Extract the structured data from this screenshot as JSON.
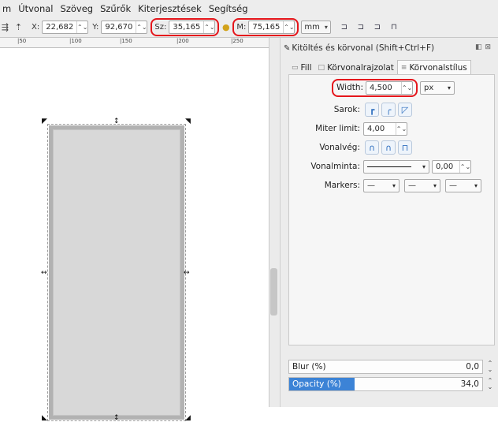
{
  "menu": [
    "m",
    "Útvonal",
    "Szöveg",
    "Szűrők",
    "Kiterjesztések",
    "Segítség"
  ],
  "toolbar": {
    "x_label": "X:",
    "x_value": "22,682",
    "y_label": "Y:",
    "y_value": "92,670",
    "w_label": "Sz:",
    "w_value": "35,165",
    "h_label": "M:",
    "h_value": "75,165",
    "unit": "mm",
    "lock_icon": "lock-icon",
    "icons": [
      "align-icon",
      "raise-icon",
      "snap-corner-icon",
      "snap-edge-icon",
      "snap-path-icon",
      "snap-node-icon"
    ]
  },
  "ruler": {
    "ticks": [
      "|50",
      "|100",
      "|150",
      "|200",
      "|250"
    ]
  },
  "panel": {
    "title": "Kitöltés és körvonal (Shift+Ctrl+F)",
    "tabs": [
      {
        "label": "Fill",
        "icon": "fill-icon"
      },
      {
        "label": "Körvonalrajzolat",
        "icon": "stroke-paint-icon"
      },
      {
        "label": "Körvonalstílus",
        "icon": "stroke-style-icon"
      }
    ],
    "width_label": "Width:",
    "width_value": "4,500",
    "width_unit": "px",
    "corners_label": "Sarok:",
    "miter_label": "Miter limit:",
    "miter_value": "4,00",
    "caps_label": "Vonalvég:",
    "dash_label": "Vonalminta:",
    "dash_offset": "0,00",
    "markers_label": "Markers:",
    "markers": [
      "—",
      "—",
      "—"
    ]
  },
  "blur": {
    "label": "Blur (%)",
    "value": "0,0",
    "fraction": 0.0
  },
  "opacity": {
    "label": "Opacity (%)",
    "value": "34,0",
    "fraction": 0.34
  },
  "colors": {
    "highlight": "#e5161c",
    "accent": "#3c83d6",
    "rect_fill": "#d8d8d8",
    "rect_stroke": "#b2b2b2"
  }
}
